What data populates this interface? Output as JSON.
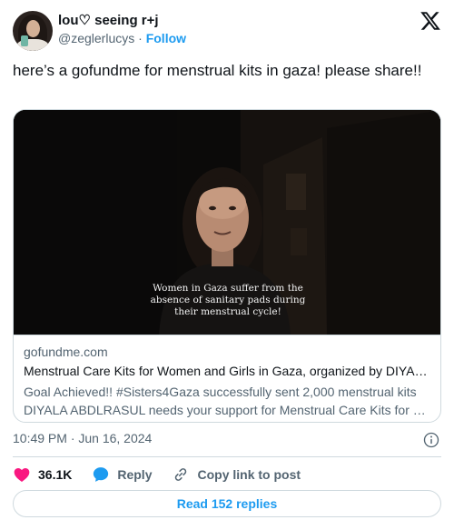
{
  "author": {
    "display_name": "lou♡ seeing r+j",
    "handle": "@zeglerlucys",
    "separator": "·",
    "follow_label": "Follow"
  },
  "tweet": {
    "text": "here’s a gofundme for menstrual kits in gaza! please share!!"
  },
  "link_card": {
    "caption_lines": [
      "Women in Gaza suffer from the",
      "absence of sanitary pads during",
      "their menstrual cycle!"
    ],
    "domain": "gofundme.com",
    "title": "Menstrual Care Kits for Women and Girls in Gaza, organized by DIYALA ABDLRASUL",
    "description_lines": [
      "Goal Achieved!! #Sisters4Gaza successfully sent 2,000 menstrual kits",
      "DIYALA ABDLRASUL needs your support for Menstrual Care Kits for Women and Girls in Gaza"
    ]
  },
  "meta": {
    "timestamp": "10:49 PM · Jun 16, 2024"
  },
  "actions": {
    "likes_count": "36.1K",
    "reply_label": "Reply",
    "copy_link_label": "Copy link to post"
  },
  "read_replies_label": "Read 152 replies",
  "icons": {
    "logo": "x-logo-icon",
    "info": "info-icon",
    "like": "heart-icon",
    "reply": "speech-bubble-icon",
    "copy": "link-icon"
  },
  "colors": {
    "accent": "#1d9bf0",
    "like": "#f91880",
    "text": "#0f1419",
    "secondary": "#536471",
    "border": "#cfd9de"
  }
}
